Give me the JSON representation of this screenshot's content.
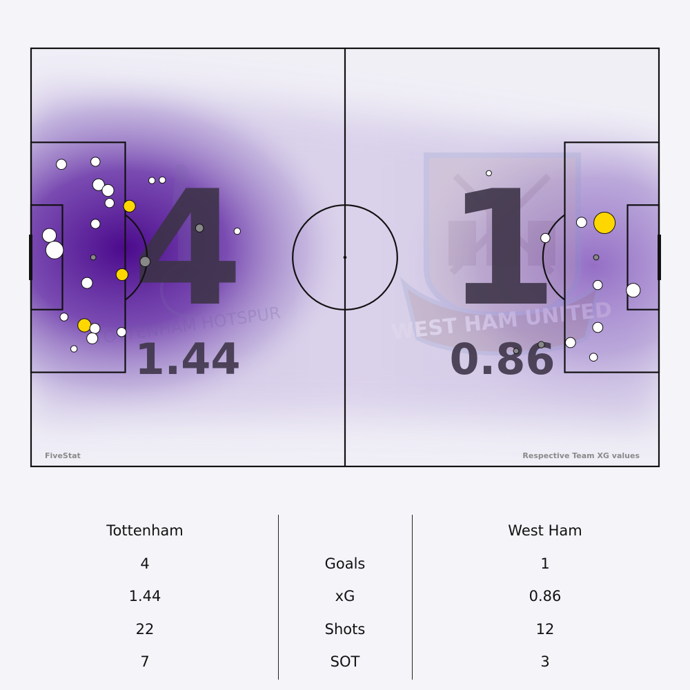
{
  "branding": {
    "source": "FiveStat",
    "note": "Respective Team XG values"
  },
  "teams": {
    "home": {
      "name": "Tottenham",
      "goals": "4",
      "xg": "1.44",
      "shots": "22",
      "sot": "7",
      "crest_text": "TOTTENHAM HOTSPUR"
    },
    "away": {
      "name": "West Ham",
      "goals": "1",
      "xg": "0.86",
      "shots": "12",
      "sot": "3",
      "crest_text": "WEST HAM UNITED"
    }
  },
  "stat_labels": {
    "goals": "Goals",
    "xg": "xG",
    "shots": "Shots",
    "sot": "SOT"
  },
  "colors": {
    "background": "#f4f4f9",
    "pitch_lines": "#111111",
    "density": "#4b0a8c",
    "goal": "#ffd700",
    "on_target": "#888888",
    "off_target": "#ffffff"
  },
  "chart_data": {
    "type": "scatter",
    "pitch": {
      "length": 120,
      "width": 80
    },
    "marker_types": [
      "goal",
      "on_target",
      "off_target"
    ],
    "home_shots": [
      {
        "x": 5.8,
        "y": 22.2,
        "xg": 0.04,
        "type": "off_target"
      },
      {
        "x": 12.3,
        "y": 21.7,
        "xg": 0.03,
        "type": "off_target"
      },
      {
        "x": 12.9,
        "y": 26.1,
        "xg": 0.06,
        "type": "off_target"
      },
      {
        "x": 14.7,
        "y": 27.2,
        "xg": 0.06,
        "type": "off_target"
      },
      {
        "x": 15.0,
        "y": 29.6,
        "xg": 0.03,
        "type": "off_target"
      },
      {
        "x": 18.8,
        "y": 30.2,
        "xg": 0.06,
        "type": "goal"
      },
      {
        "x": 23.1,
        "y": 25.3,
        "xg": 0.01,
        "type": "off_target"
      },
      {
        "x": 25.1,
        "y": 25.2,
        "xg": 0.01,
        "type": "off_target"
      },
      {
        "x": 12.3,
        "y": 33.6,
        "xg": 0.03,
        "type": "off_target"
      },
      {
        "x": 3.5,
        "y": 35.8,
        "xg": 0.09,
        "type": "off_target"
      },
      {
        "x": 4.5,
        "y": 38.6,
        "xg": 0.16,
        "type": "off_target"
      },
      {
        "x": 11.9,
        "y": 40.0,
        "xg": 0.005,
        "type": "on_target"
      },
      {
        "x": 21.8,
        "y": 40.8,
        "xg": 0.04,
        "type": "on_target"
      },
      {
        "x": 32.2,
        "y": 34.4,
        "xg": 0.02,
        "type": "on_target"
      },
      {
        "x": 39.4,
        "y": 35.0,
        "xg": 0.01,
        "type": "off_target"
      },
      {
        "x": 17.4,
        "y": 43.3,
        "xg": 0.06,
        "type": "goal"
      },
      {
        "x": 10.7,
        "y": 44.9,
        "xg": 0.05,
        "type": "off_target"
      },
      {
        "x": 6.3,
        "y": 51.4,
        "xg": 0.02,
        "type": "off_target"
      },
      {
        "x": 10.2,
        "y": 53.0,
        "xg": 0.08,
        "type": "goal"
      },
      {
        "x": 12.2,
        "y": 53.6,
        "xg": 0.04,
        "type": "off_target"
      },
      {
        "x": 11.7,
        "y": 55.5,
        "xg": 0.05,
        "type": "off_target"
      },
      {
        "x": 17.3,
        "y": 54.3,
        "xg": 0.03,
        "type": "off_target"
      },
      {
        "x": 8.2,
        "y": 57.5,
        "xg": 0.01,
        "type": "off_target"
      }
    ],
    "away_shots": [
      {
        "x": 87.5,
        "y": 23.9,
        "xg": 0.005,
        "type": "off_target"
      },
      {
        "x": 105.2,
        "y": 33.3,
        "xg": 0.04,
        "type": "off_target"
      },
      {
        "x": 109.6,
        "y": 33.4,
        "xg": 0.25,
        "type": "goal"
      },
      {
        "x": 98.3,
        "y": 36.3,
        "xg": 0.03,
        "type": "off_target"
      },
      {
        "x": 108.0,
        "y": 40.0,
        "xg": 0.005,
        "type": "on_target"
      },
      {
        "x": 108.3,
        "y": 45.3,
        "xg": 0.03,
        "type": "off_target"
      },
      {
        "x": 115.1,
        "y": 46.3,
        "xg": 0.09,
        "type": "off_target"
      },
      {
        "x": 108.3,
        "y": 53.4,
        "xg": 0.04,
        "type": "off_target"
      },
      {
        "x": 97.5,
        "y": 56.7,
        "xg": 0.01,
        "type": "on_target"
      },
      {
        "x": 103.1,
        "y": 56.3,
        "xg": 0.04,
        "type": "off_target"
      },
      {
        "x": 92.7,
        "y": 57.9,
        "xg": 0.005,
        "type": "on_target"
      },
      {
        "x": 107.5,
        "y": 59.1,
        "xg": 0.02,
        "type": "off_target"
      }
    ]
  }
}
